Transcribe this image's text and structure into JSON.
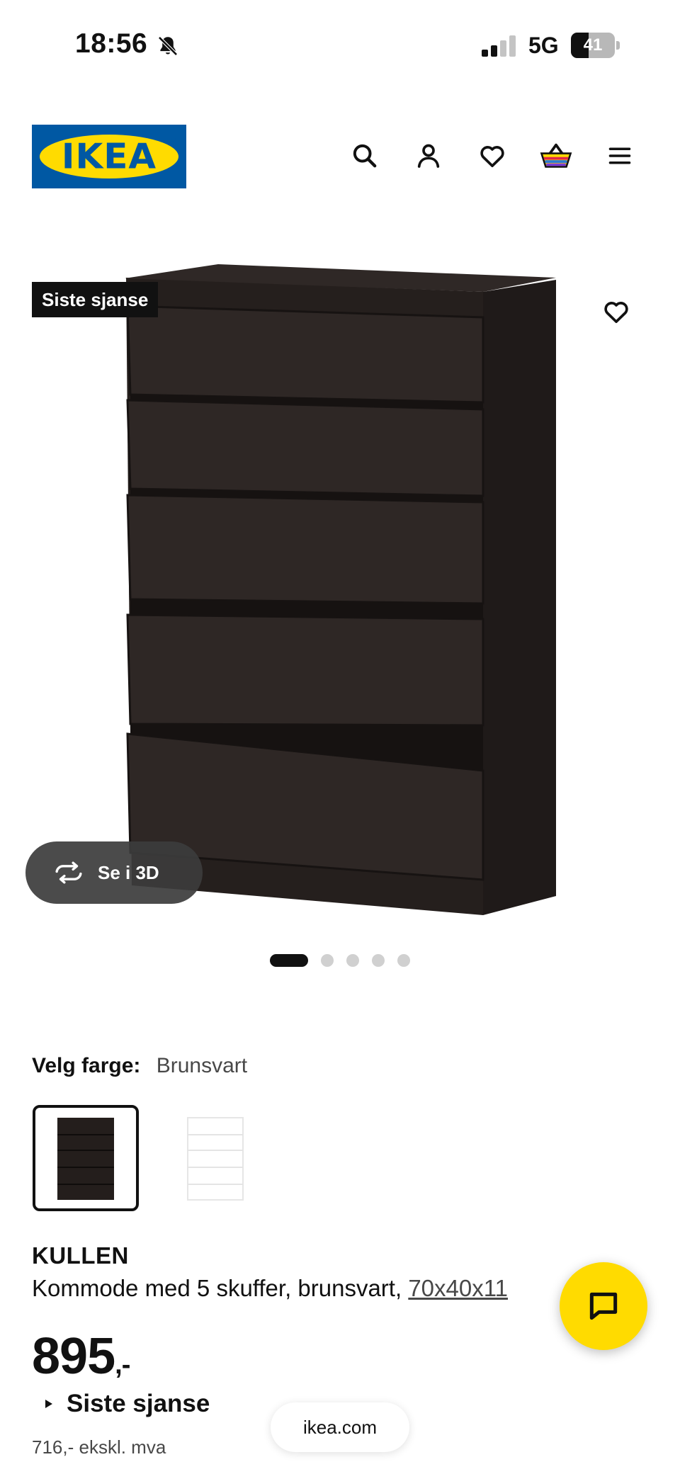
{
  "status_bar": {
    "time": "18:56",
    "network": "5G",
    "battery": "41"
  },
  "header": {
    "logo_text": "IKEA",
    "icons": [
      "search-icon",
      "account-icon",
      "heart-icon",
      "basket-icon",
      "menu-icon"
    ]
  },
  "product_image": {
    "badge": "Siste sjanse",
    "view_3d_label": "Se i 3D",
    "gallery_count": 5,
    "gallery_active_index": 0
  },
  "color": {
    "label": "Velg farge:",
    "value": "Brunsvart",
    "options": [
      "Brunsvart",
      "Hvit"
    ]
  },
  "product": {
    "name": "KULLEN",
    "description": "Kommode med 5 skuffer, brunsvart,",
    "dimensions": "70x40x11",
    "price_main": "895",
    "price_suffix": ",-",
    "offer": "Siste sjanse",
    "price_ex_vat": "716,- ekskl. mva"
  },
  "browser": {
    "url": "ikea.com"
  },
  "colors": {
    "ikea_blue": "#0058a3",
    "ikea_yellow": "#ffdb00",
    "dresser": "#2a2422"
  }
}
